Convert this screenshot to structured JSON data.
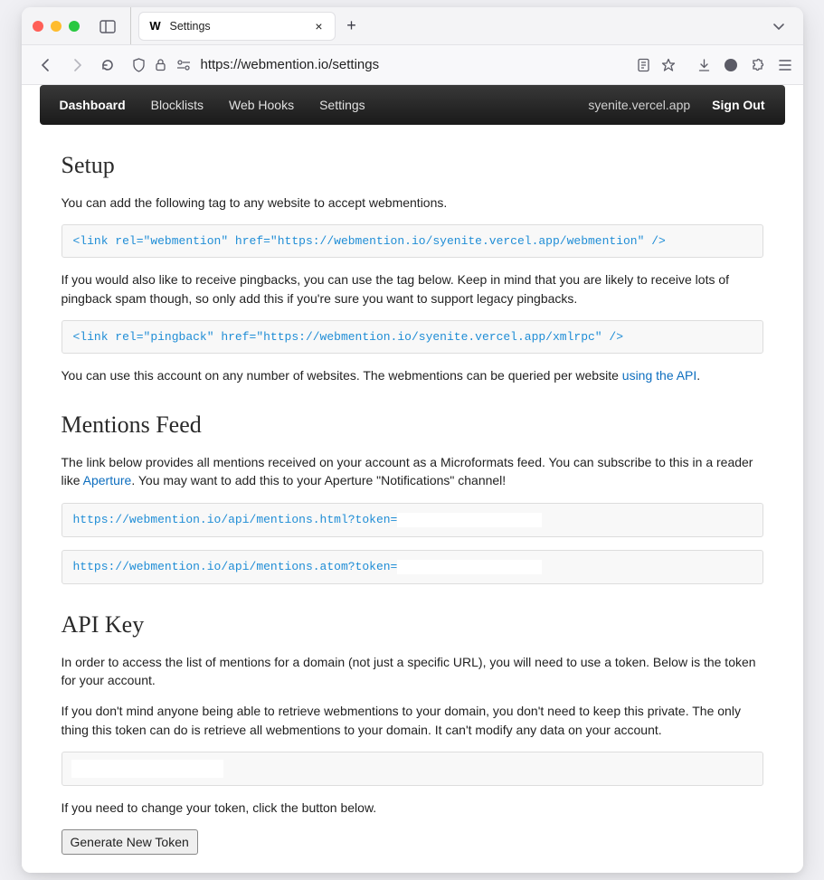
{
  "browser": {
    "tab_title": "Settings",
    "url": "https://webmention.io/settings"
  },
  "nav": {
    "items": [
      {
        "label": "Dashboard",
        "active": true
      },
      {
        "label": "Blocklists",
        "active": false
      },
      {
        "label": "Web Hooks",
        "active": false
      },
      {
        "label": "Settings",
        "active": false
      }
    ],
    "user": "syenite.vercel.app",
    "signout": "Sign Out"
  },
  "setup": {
    "heading": "Setup",
    "p1": "You can add the following tag to any website to accept webmentions.",
    "code1": "<link rel=\"webmention\" href=\"https://webmention.io/syenite.vercel.app/webmention\" />",
    "p2": "If you would also like to receive pingbacks, you can use the tag below. Keep in mind that you are likely to receive lots of pingback spam though, so only add this if you're sure you want to support legacy pingbacks.",
    "code2": "<link rel=\"pingback\" href=\"https://webmention.io/syenite.vercel.app/xmlrpc\" />",
    "p3_a": "You can use this account on any number of websites. The webmentions can be queried per website ",
    "p3_link": "using the API",
    "p3_b": "."
  },
  "feed": {
    "heading": "Mentions Feed",
    "p1_a": "The link below provides all mentions received on your account as a Microformats feed. You can subscribe to this in a reader like ",
    "p1_link": "Aperture",
    "p1_b": ". You may want to add this to your Aperture \"Notifications\" channel!",
    "code1": "https://webmention.io/api/mentions.html?token=",
    "code2": "https://webmention.io/api/mentions.atom?token="
  },
  "apikey": {
    "heading": "API Key",
    "p1": "In order to access the list of mentions for a domain (not just a specific URL), you will need to use a token. Below is the token for your account.",
    "p2": "If you don't mind anyone being able to retrieve webmentions to your domain, you don't need to keep this private. The only thing this token can do is retrieve all webmentions to your domain. It can't modify any data on your account.",
    "p3": "If you need to change your token, click the button below.",
    "button": "Generate New Token"
  }
}
